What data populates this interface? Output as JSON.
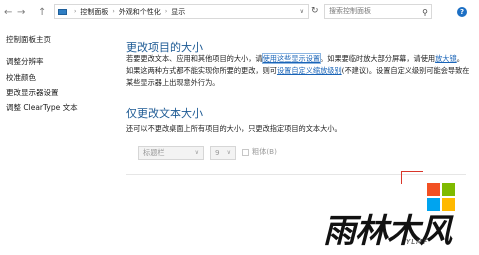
{
  "toolbar": {
    "back": "←",
    "forward": "→",
    "up": "↑",
    "refresh": "↻",
    "breadcrumb": [
      "控制面板",
      "外观和个性化",
      "显示"
    ],
    "breadcrumb_sep": "›",
    "address_dropdown": "∨",
    "search_placeholder": "搜索控制面板",
    "search_icon": "⚲",
    "help": "?"
  },
  "sidebar": {
    "items": [
      {
        "label": "控制面板主页"
      },
      {
        "label": "调整分辨率"
      },
      {
        "label": "校准颜色"
      },
      {
        "label": "更改显示器设置"
      },
      {
        "label": "调整 ClearType 文本"
      }
    ]
  },
  "main": {
    "section1_title": "更改项目的大小",
    "p1_a": "若要更改文本、应用和其他项目的大小，请",
    "p1_link1": "使用这些显示设置",
    "p1_b": "。如果要临时放大部分屏幕，请使用",
    "p1_link2": "放大镜",
    "p1_c": "。如果这两种方式都不能实现你所要的更改，则可",
    "p1_link3": "设置自定义缩放级别",
    "p1_d": "(不建议)。设置自定义级别可能会导致在某些显示器上出现意外行为。",
    "section2_title": "仅更改文本大小",
    "section2_desc": "还可以不更改桌面上所有项目的大小，只更改指定项目的文本大小。",
    "item_select": "标题栏",
    "size_select": "9",
    "dropdown_arrow": "∨",
    "bold_label": "粗体(B)"
  },
  "watermark": {
    "logo_colors": [
      "#f25022",
      "#7fba00",
      "#00a4ef",
      "#ffb900"
    ],
    "brand": "雨林木风",
    "brand_sub": "YLMF"
  }
}
